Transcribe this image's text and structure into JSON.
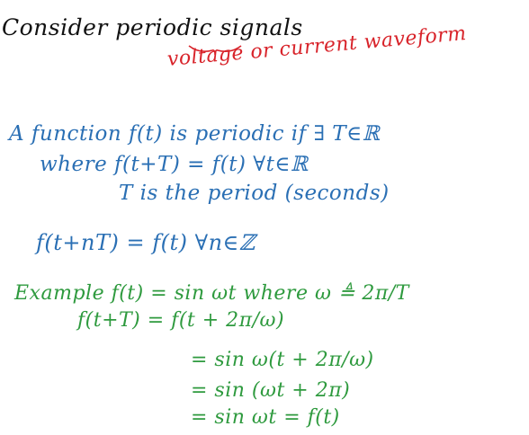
{
  "colors": {
    "black": "#111111",
    "red": "#d8232a",
    "blue": "#2a6fb4",
    "green": "#2e9a3e"
  },
  "notes": {
    "title": "Consider periodic signals",
    "annotation": "voltage or current waveform",
    "definition": [
      "A function f(t) is periodic if ∃ T∈ℝ",
      "where f(t+T) = f(t)  ∀t∈ℝ",
      "T is the period (seconds)",
      "f(t+nT) = f(t)  ∀n∈ℤ"
    ],
    "example": [
      "Example  f(t) = sin ωt  where  ω ≜ 2π/T",
      "f(t+T) = f(t + 2π/ω)",
      "= sin ω(t + 2π/ω)",
      "= sin (ωt + 2π)",
      "= sin ωt  =  f(t)"
    ]
  }
}
